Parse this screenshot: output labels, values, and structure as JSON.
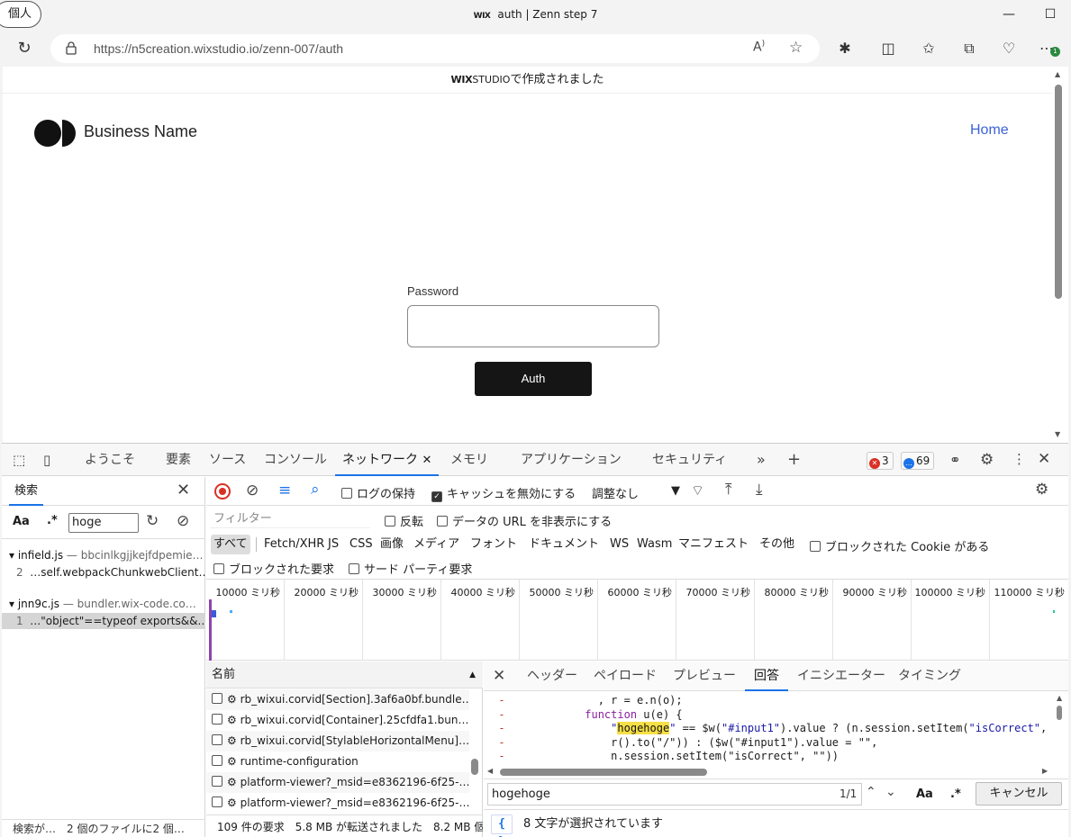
{
  "browser": {
    "profile_label": "個人",
    "window_title_brand": "WIX",
    "window_title": "auth | Zenn step 7",
    "url": "https://n5creation.wixstudio.io/zenn-007/auth",
    "extensions_badge": "1"
  },
  "page": {
    "banner_brand": "WIX",
    "banner_studio": "STUDIO",
    "banner_text": "で作成されました",
    "business_name": "Business Name",
    "nav_home": "Home",
    "password_label": "Password",
    "password_value": "",
    "auth_button": "Auth"
  },
  "devtools": {
    "tabs": [
      "ようこそ",
      "要素",
      "ソース",
      "コンソール",
      "ネットワーク",
      "メモリ",
      "アプリケーション",
      "セキュリティ"
    ],
    "active_tab": "ネットワーク",
    "error_count": "3",
    "message_count": "69",
    "search_panel": {
      "tab_label": "検索",
      "case_label": "Aa",
      "regex_label": ".*",
      "query": "hoge",
      "results": [
        {
          "file": "infield.js",
          "source": "— bbcinlkgjjkejfdpemie…",
          "line_no": "2",
          "snippet": "…self.webpackChunkwebClient…"
        },
        {
          "file": "jnn9c.js",
          "source": "— bundler.wix-code.co…",
          "line_no": "1",
          "snippet": "…\"object\"==typeof exports&&…"
        }
      ],
      "status": "検索が…　2 個のファイルに2 個…"
    },
    "network": {
      "preserve_log": "ログの保持",
      "disable_cache": "キャッシュを無効にする",
      "throttling": "調整なし",
      "filter_placeholder": "フィルター",
      "invert": "反転",
      "hide_data_urls": "データの URL を非表示にする",
      "types": [
        "すべて",
        "Fetch/XHR",
        "JS",
        "CSS",
        "画像",
        "メディア",
        "フォント",
        "ドキュメント",
        "WS",
        "Wasm",
        "マニフェスト",
        "その他"
      ],
      "blocked_cookies": "ブロックされた Cookie がある",
      "blocked_requests": "ブロックされた要求",
      "third_party": "サード パーティ要求",
      "timeline_ticks": [
        "10000 ミリ秒",
        "20000 ミリ秒",
        "30000 ミリ秒",
        "40000 ミリ秒",
        "50000 ミリ秒",
        "60000 ミリ秒",
        "70000 ミリ秒",
        "80000 ミリ秒",
        "90000 ミリ秒",
        "100000 ミリ秒",
        "110000 ミリ秒"
      ],
      "name_header": "名前",
      "requests": [
        "rb_wixui.corvid[Section].3af6a0bf.bundle…",
        "rb_wixui.corvid[Container].25cfdfa1.bun…",
        "rb_wixui.corvid[StylableHorizontalMenu]…",
        "runtime-configuration",
        "platform-viewer?_msid=e8362196-6f25-…",
        "platform-viewer?_msid=e8362196-6f25-…"
      ],
      "summary": "109 件の要求　5.8 MB が転送されました　8.2 MB 個"
    },
    "detail": {
      "tabs": [
        "ヘッダー",
        "ペイロード",
        "プレビュー",
        "回答",
        "イニシエーター",
        "タイミング"
      ],
      "active_tab": "回答",
      "code": {
        "l1": ", r = e.n(o);",
        "l2_kw": "function",
        "l2": " u(e) {",
        "l3_q1": "\"",
        "l3_hl": "hogehoge",
        "l3_q2": "\"",
        "l3_rest": " == $w(",
        "l3_str1": "\"#input1\"",
        "l3_rest2": ").value ? (n.session.setItem(",
        "l3_str2": "\"isCorrect\"",
        "l3_end": ",",
        "l4": "r().to(\"/\")) : ($w(\"#input1\").value = \"\",",
        "l5": "n.session.setItem(\"isCorrect\", \"\"))"
      },
      "find_value": "hogehoge",
      "find_count": "1/1",
      "find_case": "Aa",
      "find_regex": ".*",
      "cancel": "キャンセル",
      "format_label": "{ }",
      "selection_status": "8 文字が選択されています"
    }
  }
}
